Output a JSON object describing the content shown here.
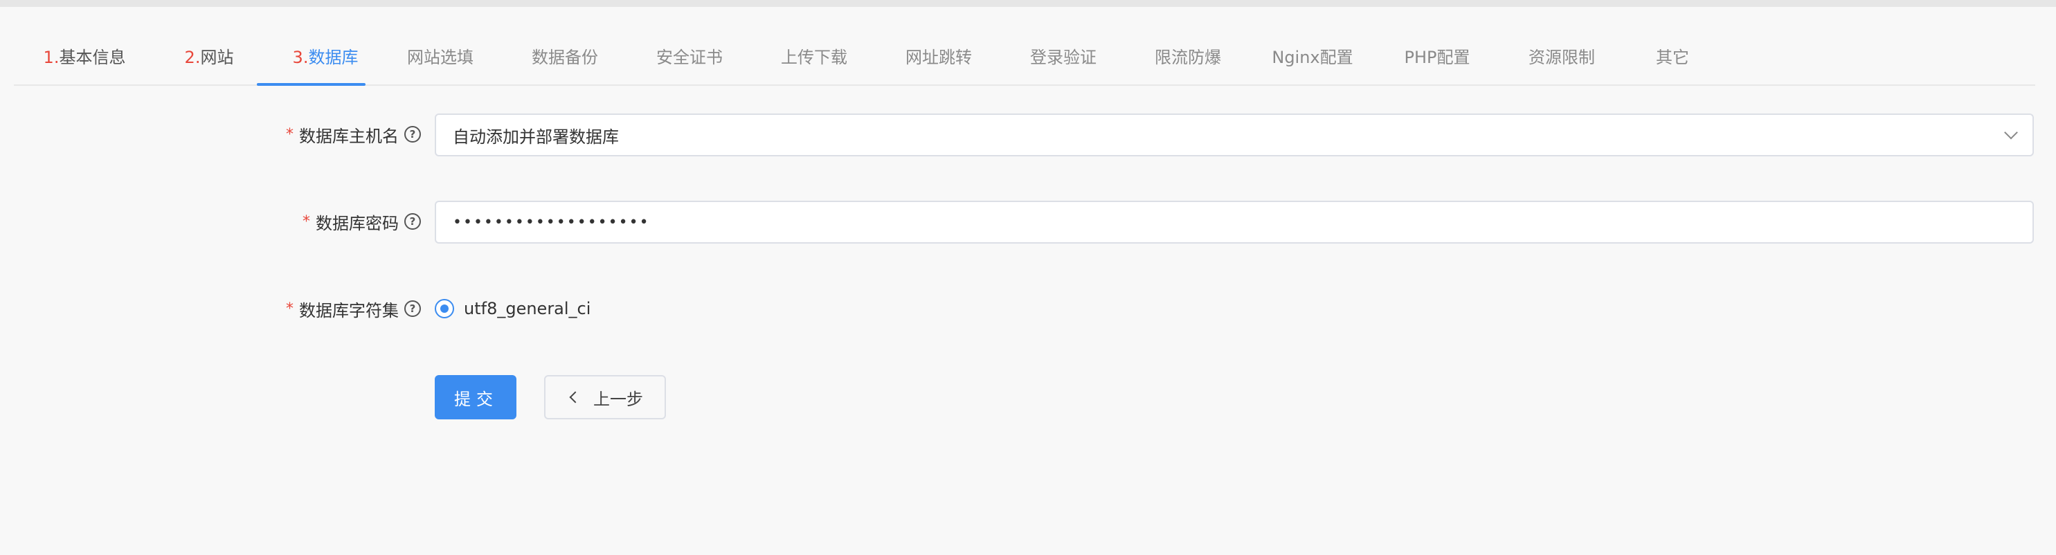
{
  "tabs": [
    {
      "num": "1.",
      "label": "基本信息",
      "state": "done"
    },
    {
      "num": "2.",
      "label": "网站",
      "state": "done"
    },
    {
      "num": "3.",
      "label": "数据库",
      "state": "active"
    },
    {
      "num": "",
      "label": "网站选填",
      "state": "todo"
    },
    {
      "num": "",
      "label": "数据备份",
      "state": "todo"
    },
    {
      "num": "",
      "label": "安全证书",
      "state": "todo"
    },
    {
      "num": "",
      "label": "上传下载",
      "state": "todo"
    },
    {
      "num": "",
      "label": "网址跳转",
      "state": "todo"
    },
    {
      "num": "",
      "label": "登录验证",
      "state": "todo"
    },
    {
      "num": "",
      "label": "限流防爆",
      "state": "todo"
    },
    {
      "num": "",
      "label": "Nginx配置",
      "state": "todo"
    },
    {
      "num": "",
      "label": "PHP配置",
      "state": "todo"
    },
    {
      "num": "",
      "label": "资源限制",
      "state": "todo"
    },
    {
      "num": "",
      "label": "其它",
      "state": "todo"
    }
  ],
  "form": {
    "required_mark": "*",
    "help_icon": "?",
    "db_host": {
      "label": "数据库主机名",
      "value": "自动添加并部署数据库"
    },
    "db_password": {
      "label": "数据库密码",
      "value": "•••••••••••••••••••"
    },
    "db_charset": {
      "label": "数据库字符集",
      "option": "utf8_general_ci",
      "selected": true
    }
  },
  "buttons": {
    "submit": "提交",
    "prev": "上一步"
  },
  "colors": {
    "accent": "#3b8cf0",
    "required": "#e8473b",
    "background": "#f8f8f8"
  },
  "icons": {
    "help": "help-circle-icon",
    "dropdown": "chevron-down-icon",
    "back": "chevron-left-icon",
    "radio": "radio-selected-icon"
  }
}
